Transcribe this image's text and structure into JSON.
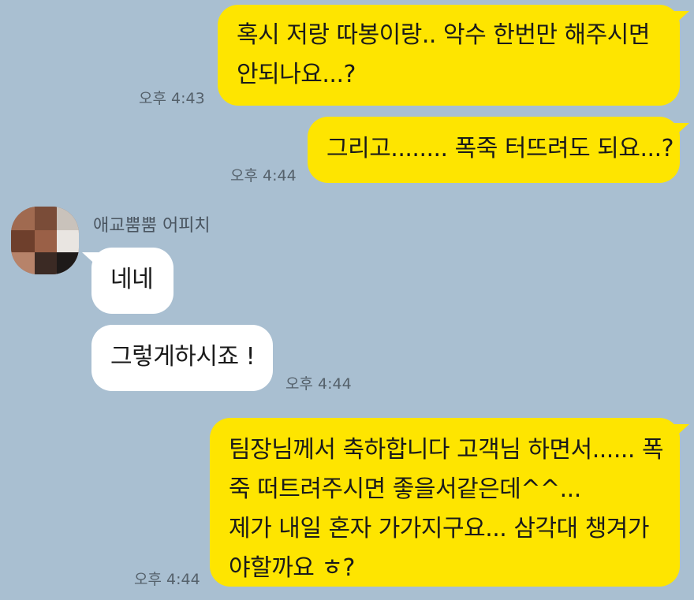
{
  "messages": [
    {
      "from": "me",
      "lines": [
        "혹시 저랑 따봉이랑.. 악수 한번만 해주시면",
        "안되나요...?"
      ],
      "time": "오후 4:43"
    },
    {
      "from": "me",
      "lines": [
        "그리고........ 폭죽 터뜨려도 되요...?"
      ],
      "time": "오후 4:44"
    },
    {
      "from": "them",
      "sender": "애교뿜뿜 어피치",
      "lines": [
        "네네"
      ]
    },
    {
      "from": "them",
      "lines": [
        "그렇게하시죠 !"
      ],
      "time": "오후 4:44"
    },
    {
      "from": "me",
      "lines": [
        "팀장님께서 축하합니다 고객님 하면서...... 폭",
        "죽 떠트려주시면 좋을서같은데^^...",
        "제가 내일 혼자 가가지구요... 삼각대 챙겨가",
        "야할까요 ㅎ?"
      ],
      "time": "오후 4:44"
    }
  ],
  "colors": {
    "background": "#a9bfd1",
    "my_bubble": "#fee500",
    "their_bubble": "#ffffff"
  },
  "icons": {
    "avatar": "blurred-profile-avatar"
  }
}
